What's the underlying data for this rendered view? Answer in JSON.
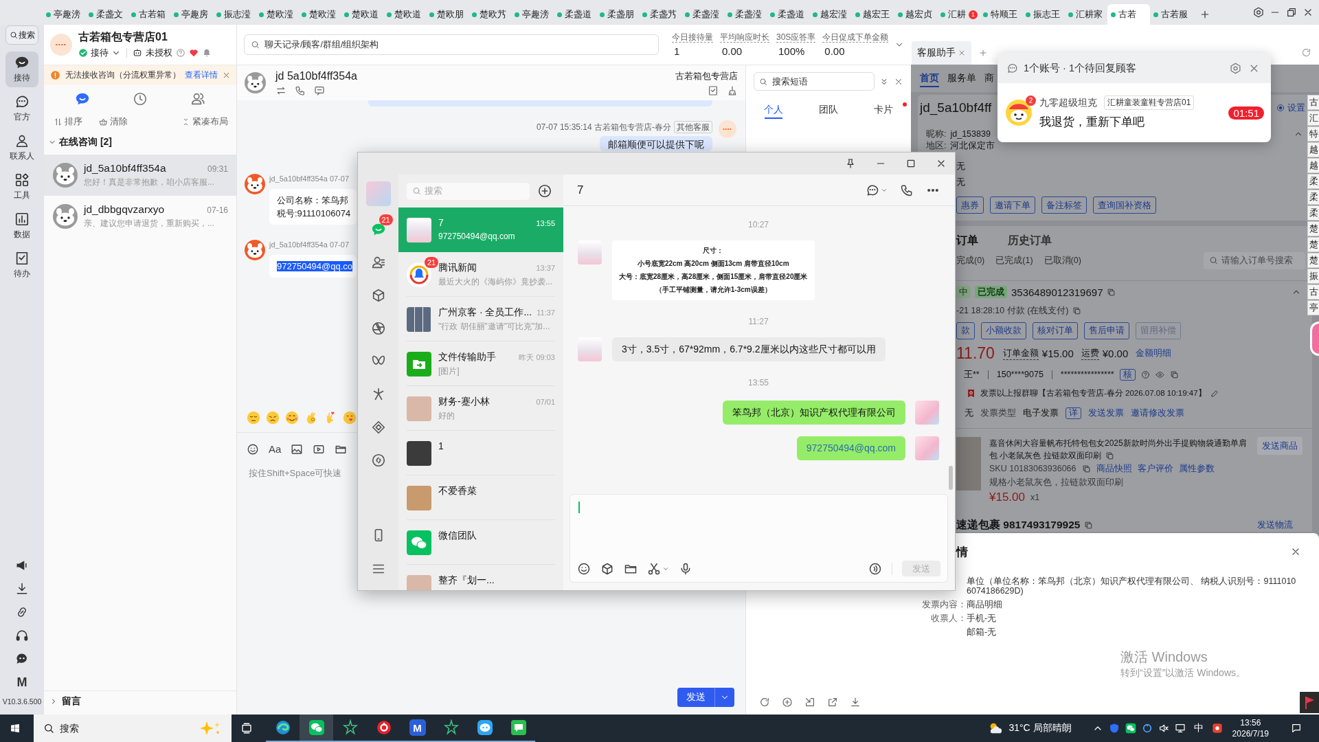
{
  "top_tabs": [
    {
      "label": "亭趣滂",
      "selected": false
    },
    {
      "label": "柔盏文",
      "selected": false
    },
    {
      "label": "古若箱",
      "selected": false
    },
    {
      "label": "亭趣房",
      "selected": false
    },
    {
      "label": "振志滢",
      "selected": false
    },
    {
      "label": "楚欧滢",
      "selected": false
    },
    {
      "label": "楚欧滢",
      "selected": false
    },
    {
      "label": "楚欧道",
      "selected": false
    },
    {
      "label": "楚欧道",
      "selected": false
    },
    {
      "label": "楚欧朋",
      "selected": false
    },
    {
      "label": "楚欧艿",
      "selected": false
    },
    {
      "label": "亭趣滂",
      "selected": false
    },
    {
      "label": "柔盏道",
      "selected": false
    },
    {
      "label": "柔盏朋",
      "selected": false
    },
    {
      "label": "柔盏艿",
      "selected": false
    },
    {
      "label": "柔盏滢",
      "selected": false
    },
    {
      "label": "柔盏滢",
      "selected": false
    },
    {
      "label": "柔盏道",
      "selected": false
    },
    {
      "label": "越宏滢",
      "selected": false
    },
    {
      "label": "越宏王",
      "selected": false
    },
    {
      "label": "越宏贞",
      "selected": false
    },
    {
      "label": "汇耕",
      "selected": false,
      "badge": "1"
    },
    {
      "label": "特顺王",
      "selected": false
    },
    {
      "label": "振志王",
      "selected": false
    },
    {
      "label": "汇耕家",
      "selected": false
    },
    {
      "label": "古若",
      "selected": true
    },
    {
      "label": "古若服",
      "selected": false
    }
  ],
  "left_rail": {
    "search": "搜索",
    "items": [
      {
        "label": "接待",
        "selected": true
      },
      {
        "label": "官方",
        "selected": false
      },
      {
        "label": "联系人",
        "selected": false
      },
      {
        "label": "工具",
        "selected": false
      },
      {
        "label": "数据",
        "selected": false
      },
      {
        "label": "待办",
        "selected": false
      }
    ],
    "logo_letter": "M",
    "version": "V10.3.6.500"
  },
  "store": {
    "name": "古若箱包专营店01",
    "status": "接待",
    "authorization": "未授权"
  },
  "warning": {
    "text": "无法接收咨询（分流权重异常）",
    "link": "查看详情"
  },
  "list_tabs": [
    {
      "selected": true
    },
    {
      "selected": false
    },
    {
      "selected": false
    }
  ],
  "list_tools": {
    "sort": "排序",
    "clear": "清除",
    "layout": "紧凑布局"
  },
  "online": {
    "title": "在线咨询 [2]",
    "expanded": true,
    "conversations": [
      {
        "name": "jd_5a10bf4ff354a",
        "time": "09:31",
        "preview": "您好！真是非常抱歉，咱小店客服...",
        "selected": true
      },
      {
        "name": "jd_dbbgqvzarxyo",
        "time": "07-16",
        "preview": "亲、建议您申请退货，重新购买，...",
        "selected": false
      }
    ]
  },
  "messages_section": {
    "title": "留言",
    "expanded": false
  },
  "top_search": {
    "placeholder": "聊天记录/顾客/群组/组织架构"
  },
  "stats": [
    {
      "label": "今日接待量",
      "value": "1"
    },
    {
      "label": "平均响应时长",
      "value": "0.00"
    },
    {
      "label": "30S应答率",
      "value": "100%"
    },
    {
      "label": "今日促成下单金额",
      "value": "0.00"
    }
  ],
  "chat": {
    "customer": "jd 5a10bf4ff354a",
    "shop": "古若箱包专营店",
    "messages": [
      {
        "kind": "clipped"
      },
      {
        "kind": "outgoing",
        "meta": "07-07 15:35:14 古若箱包专营店-春分",
        "tag": "其他客服",
        "lines": [
          "邮箱顺便可以提供下呢"
        ],
        "highlighted": false
      },
      {
        "kind": "incoming",
        "meta": "jd_5a10bf4ff354a 07-07",
        "lines": [
          "公司名称：笨鸟邦",
          "税号:91110106074"
        ],
        "highlighted": false
      },
      {
        "kind": "incoming",
        "meta": "jd_5a10bf4ff354a 07-07",
        "lines": [
          "972750494@qq.co"
        ],
        "highlighted": true
      }
    ],
    "font_tool": "Aa",
    "placeholder": "按住Shift+Space可快速",
    "send": "发送"
  },
  "phrases": {
    "placeholder": "搜索短语",
    "tabs": [
      {
        "label": "个人",
        "selected": true,
        "dot": false
      },
      {
        "label": "团队",
        "selected": false,
        "dot": false
      },
      {
        "label": "卡片",
        "selected": false,
        "dot": true
      }
    ]
  },
  "wechat": {
    "nav": [
      {
        "selected": true,
        "badge": "21"
      },
      {
        "selected": false
      },
      {
        "selected": false
      },
      {
        "selected": false
      },
      {
        "selected": false
      },
      {
        "selected": false
      },
      {
        "selected": false
      },
      {
        "selected": false
      }
    ],
    "search": {
      "placeholder": "搜索"
    },
    "chats": [
      {
        "name": "7",
        "preview": "972750494@qq.com",
        "time": "13:55",
        "selected": true,
        "kind": "anime"
      },
      {
        "name": "腾讯新闻",
        "preview": "最近大火的《海屿你》竟抄袭...",
        "time": "13:37",
        "selected": false,
        "kind": "news",
        "badge": "21"
      },
      {
        "name": "广州京客 · 全员工作...",
        "preview": "\"行政 胡佳丽\"邀请\"可比克\"加...",
        "time": "11:37",
        "selected": false,
        "kind": "collage"
      },
      {
        "name": "文件传输助手",
        "preview": "[图片]",
        "time": "昨天 09:03",
        "selected": false,
        "kind": "file"
      },
      {
        "name": "财务-蹇小林",
        "preview": "好的",
        "time": "07/01",
        "selected": false,
        "kind": "photo"
      },
      {
        "name": "1",
        "selected": false,
        "kind": "photo"
      },
      {
        "name": "不爱香菜",
        "selected": false,
        "kind": "photo"
      },
      {
        "name": "微信团队",
        "selected": false,
        "kind": "wechat"
      },
      {
        "name": "整齐『划一...",
        "selected": false,
        "kind": "photo"
      }
    ],
    "title": "7",
    "messages": [
      {
        "kind": "time",
        "text": "10:27"
      },
      {
        "kind": "image_card",
        "lines": [
          "尺寸：",
          "小号底宽22cm 高20cm 侧面13cm 肩带直径10cm",
          "大号：底宽28厘米，高28厘米，侧面15厘米，肩带直径20厘米",
          "（手工平铺测量，请允许1-3cm误差）"
        ]
      },
      {
        "kind": "time",
        "text": "11:27"
      },
      {
        "kind": "received",
        "text": "3寸，3.5寸，67*92mm，6.7*9.2厘米以内这些尺寸都可以用"
      },
      {
        "kind": "time",
        "text": "13:55"
      },
      {
        "kind": "sent",
        "text": "笨鸟邦（北京）知识产权代理有限公司",
        "link": false
      },
      {
        "kind": "sent",
        "text": "972750494@qq.com",
        "link": true
      }
    ],
    "send": "发送"
  },
  "assistant": {
    "tab": "客服助手",
    "nav": [
      {
        "label": "首页",
        "selected": true
      },
      {
        "label": "服务单",
        "selected": false
      },
      {
        "label": "商",
        "selected": false
      }
    ],
    "customer": "jd_5a10bf4ff",
    "settings": {
      "label": "设置",
      "checked": true
    },
    "fields": [
      {
        "label": "昵称:",
        "value": "jd_153839"
      },
      {
        "label": "地区:",
        "value": "河北保定市"
      }
    ],
    "field_values": [
      "无",
      "无"
    ],
    "actions": [
      "惠券",
      "邀请下单",
      "备注标签",
      "查询国补资格"
    ],
    "order_tabs": [
      {
        "label": "订单",
        "selected": true
      },
      {
        "label": "历史订单",
        "selected": false
      }
    ],
    "filters": [
      "完成(0)",
      "已完成(1)",
      "已取消(0)"
    ],
    "order_search": {
      "placeholder": "请输入订单号搜索"
    },
    "order": {
      "channel": "中",
      "status": "已完成",
      "number": "3536489012319697",
      "paid": "-21 18:28:10 付款 (在线支付)",
      "actions": [
        {
          "label": "款",
          "disabled": false
        },
        {
          "label": "小额收款",
          "disabled": false
        },
        {
          "label": "核对订单",
          "disabled": false
        },
        {
          "label": "售后申请",
          "disabled": false
        },
        {
          "label": "留用补偿",
          "disabled": true
        }
      ],
      "paid_amount": "11.70",
      "total_label": "订单金额",
      "total": "¥15.00",
      "freight_label": "运费",
      "freight": "¥0.00",
      "amount_link": "金额明细",
      "buyer": "王**",
      "phone": "150****9075",
      "address": "****************",
      "verify": "核",
      "invoice_note": "发票以上报群聊【古若箱包专营店-春分 2026.07.08 10:19:47】",
      "invoice_title": "无",
      "invoice_type_label": "发票类型",
      "invoice_type": "电子发票",
      "invoice_detail": "详",
      "invoice_links": [
        "发送发票",
        "邀请修改发票"
      ],
      "product": {
        "title": "嘉音休闲大容量帆布托特包包女2025新款时尚外出手提购物袋通勤单肩包 小老鼠灰色 拉链款双面印刷",
        "sku": "SKU 10183063936066",
        "links": [
          "商品快照",
          "客户评价",
          "属性参数"
        ],
        "spec": "规格小老鼠灰色，拉链款双面印刷",
        "price": "¥15.00",
        "quantity": "x1",
        "send": "发送商品"
      },
      "parcel": "速递包裹 9817493179925",
      "parcel_link": "发送物流"
    },
    "drawer": {
      "title": "情",
      "rows": [
        {
          "value": "单位（单位名称：笨鸟邦（北京）知识产权代理有限公司、 纳税人识别号：91110106074186629D)"
        },
        {
          "label": "发票内容：",
          "value": "商品明细"
        },
        {
          "label": "收票人：",
          "value": "手机-无"
        },
        {
          "value": "邮箱-无"
        }
      ]
    },
    "side_tabs": [
      "古",
      "汇",
      "特",
      "越",
      "越",
      "柔",
      "柔",
      "柔",
      "楚",
      "楚",
      "楚",
      "振",
      "古",
      "亭"
    ]
  },
  "notification": {
    "title": "1个账号 · 1个待回复顾客",
    "badge": "2",
    "customer": "九零超级坦克",
    "shop": "汇耕童装童鞋专营店01",
    "message": "我退货，重新下单吧",
    "timer": "01:51"
  },
  "activation": {
    "title": "激活 Windows",
    "hint": "转到“设置”以激活 Windows。"
  },
  "taskbar": {
    "search": {
      "placeholder": "搜索"
    },
    "apps": [
      {
        "selected": false,
        "running": true
      },
      {
        "selected": true,
        "running": true
      },
      {
        "selected": false,
        "running": true
      },
      {
        "selected": false,
        "running": true
      },
      {
        "selected": false,
        "running": true,
        "letter": "M"
      },
      {
        "selected": false,
        "running": true
      },
      {
        "selected": false,
        "running": true
      },
      {
        "selected": false,
        "running": true
      }
    ],
    "weather": "31°C 局部晴朗",
    "ime": "中",
    "time": "13:56",
    "date": "2026/7/19"
  }
}
